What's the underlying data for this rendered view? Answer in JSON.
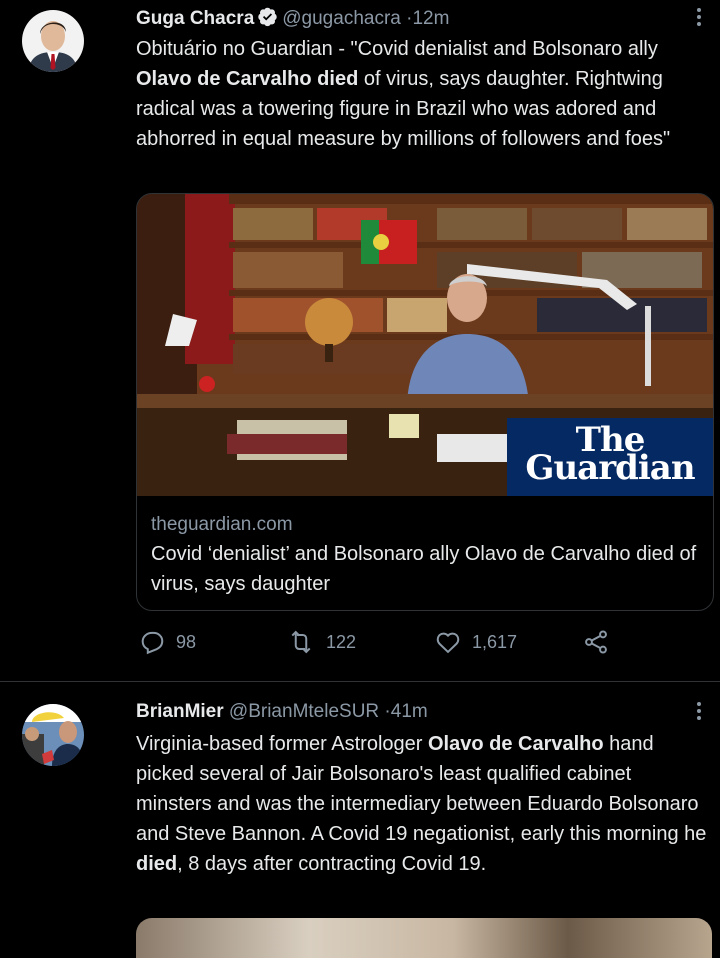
{
  "tweets": [
    {
      "name": "Guga Chacra",
      "handle": "@gugachacra",
      "separator": "·",
      "time": "12m",
      "verified": true,
      "text": {
        "p1": "Obituário no Guardian - \"Covid denialist and Bolsonaro ally ",
        "b1": "Olavo de Carvalho died",
        "p2": " of virus, says daughter. Rightwing radical was a towering figure in Brazil who was adored and abhorred in equal measure by millions of followers and foes\""
      },
      "card": {
        "logo_line1": "The",
        "logo_line2": "Guardian",
        "domain": "theguardian.com",
        "title": "Covid ‘denialist’ and Bolsonaro ally Olavo de Carvalho died of virus, says daughter"
      },
      "actions": {
        "replies": "98",
        "retweets": "122",
        "likes": "1,617"
      }
    },
    {
      "name": "BrianMier",
      "handle": "@BrianMteleSUR",
      "separator": "·",
      "time": "41m",
      "verified": false,
      "text": {
        "p1": "Virginia-based former Astrologer ",
        "b1": "Olavo de Carvalho",
        "p2": " hand picked several of Jair Bolsonaro's least qualified cabinet minsters and was the intermediary between Eduardo Bolsonaro and Steve Bannon. A Covid 19 negationist, early this morning he ",
        "b2": "died",
        "p3": ", 8 days after contracting Covid 19."
      }
    }
  ],
  "colors": {
    "background": "#000000",
    "text": "#e7e9ea",
    "secondary": "#8b98a5",
    "verified": "#e7e9ea",
    "guardian_blue": "#052962"
  },
  "icons": [
    "verified-badge-icon",
    "more-icon",
    "reply-icon",
    "retweet-icon",
    "like-icon",
    "share-icon"
  ]
}
